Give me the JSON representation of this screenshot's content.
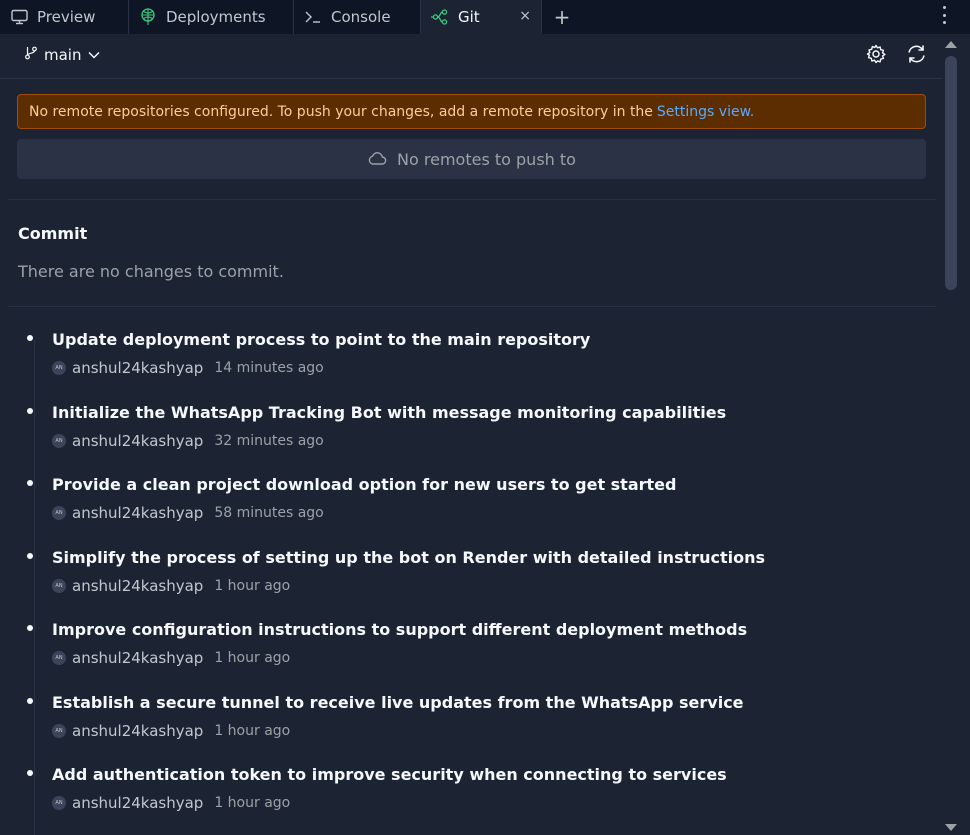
{
  "tabs": {
    "preview": "Preview",
    "deployments": "Deployments",
    "console": "Console",
    "git": "Git",
    "close": "×",
    "add": "+"
  },
  "toolbar": {
    "branch": "main"
  },
  "warning": {
    "text": "No remote repositories configured. To push your changes, add a remote repository in the",
    "link": "Settings view."
  },
  "push": {
    "label": "No remotes to push to"
  },
  "commit": {
    "title": "Commit",
    "empty": "There are no changes to commit."
  },
  "history": [
    {
      "message": "Update deployment process to point to the main repository",
      "avatar": "AN",
      "author": "anshul24kashyap",
      "time": "14 minutes ago"
    },
    {
      "message": "Initialize the WhatsApp Tracking Bot with message monitoring capabilities",
      "avatar": "AN",
      "author": "anshul24kashyap",
      "time": "32 minutes ago"
    },
    {
      "message": "Provide a clean project download option for new users to get started",
      "avatar": "AN",
      "author": "anshul24kashyap",
      "time": "58 minutes ago"
    },
    {
      "message": "Simplify the process of setting up the bot on Render with detailed instructions",
      "avatar": "AN",
      "author": "anshul24kashyap",
      "time": "1 hour ago"
    },
    {
      "message": "Improve configuration instructions to support different deployment methods",
      "avatar": "AN",
      "author": "anshul24kashyap",
      "time": "1 hour ago"
    },
    {
      "message": "Establish a secure tunnel to receive live updates from the WhatsApp service",
      "avatar": "AN",
      "author": "anshul24kashyap",
      "time": "1 hour ago"
    },
    {
      "message": "Add authentication token to improve security when connecting to services",
      "avatar": "AN",
      "author": "anshul24kashyap",
      "time": "1 hour ago"
    }
  ],
  "colors": {
    "background": "#1c2333",
    "tabbar": "#0e1525",
    "warning_bg": "#5c2d00",
    "warning_text": "#ffcc99",
    "link": "#57abff",
    "git_icon": "#3dcc7e"
  }
}
